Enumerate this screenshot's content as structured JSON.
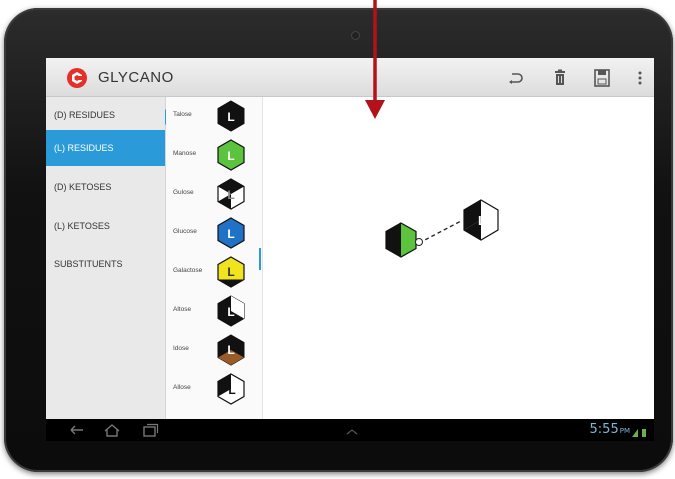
{
  "app": {
    "title": "GLYCANO"
  },
  "toolbar": {
    "undo_icon": "undo-icon",
    "delete_icon": "trash-icon",
    "save_icon": "save-icon",
    "overflow_icon": "overflow-menu-icon"
  },
  "categories": [
    {
      "label": "(D) RESIDUES",
      "active": false
    },
    {
      "label": "(L) RESIDUES",
      "active": true
    },
    {
      "label": "(D) KETOSES",
      "active": false
    },
    {
      "label": "(L) KETOSES",
      "active": false
    },
    {
      "label": "SUBSTITUENTS",
      "active": false
    }
  ],
  "residues": [
    {
      "name": "Talose",
      "letter": "L",
      "color": "#111111"
    },
    {
      "name": "Manose",
      "letter": "L",
      "color": "#5cc33f"
    },
    {
      "name": "Gulose",
      "letter": "L",
      "color": "#ffffff"
    },
    {
      "name": "Glucose",
      "letter": "L",
      "color": "#1f72c6"
    },
    {
      "name": "Galactose",
      "letter": "L",
      "color": "#f1e31d"
    },
    {
      "name": "Altose",
      "letter": "L",
      "color": "#111111"
    },
    {
      "name": "Idose",
      "letter": "L",
      "color": "#9a5a2a"
    },
    {
      "name": "Allose",
      "letter": "L",
      "color": "#ffffff"
    }
  ],
  "canvas": {
    "nodes": [
      {
        "name": "Manose",
        "letter": "",
        "color": "#5cc33f"
      },
      {
        "name": "Gulose",
        "letter": "L",
        "color": "#ffffff"
      }
    ]
  },
  "status": {
    "time": "5:55",
    "ampm": "PM"
  },
  "colors": {
    "accent": "#2a9bd8",
    "logo": "#e5302a",
    "arrow": "#b3121a"
  }
}
